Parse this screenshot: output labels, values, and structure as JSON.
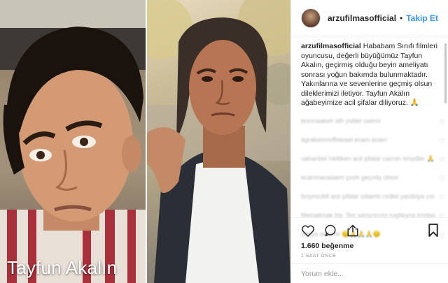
{
  "post": {
    "photo_caption": "Tayfun Akalın"
  },
  "header": {
    "username": "arzufilmasofficial",
    "separator": "•",
    "follow_label": "Takip Et"
  },
  "caption": {
    "username": "arzufilmasofficial",
    "text": " Hababam Sınıfı filmleri oyuncusu, değerli büyüğümüz Tayfun Akalın, geçirmiş olduğu beyin ameliyatı sonrası yoğun bakımda bulunmaktadır. Yakınlarına ve sevenlerine geçmiş olsun dileklerimizi iletiyor. Tayfun Akalın ağabeyimize acil şifalar diliyoruz. 🙏"
  },
  "comments": [
    {
      "text": "tesnnaakeh sth ystlier ceemi",
      "heart": "♡"
    },
    {
      "text": "agrakenmoffsteael ecam ecam",
      "heart": "♡"
    },
    {
      "text": "uahanbel Helliken acil şifalar cacnin nmydler 🙏",
      "heart": "♡"
    },
    {
      "text": "ecanmanaiaem çooh geçmtş olson",
      "heart": "♡"
    },
    {
      "text": "fssymcddl acil şifalar cdaerin nrdlet yardiriya cm",
      "heart": "♡"
    },
    {
      "text": "Meinalimak hiy. Teo sarsırsrırnı rugiteyna lrnnlas",
      "heart": "♡"
    },
    {
      "text": "athiya secerel 😔🙏🙏🙏😔",
      "heart": "♡"
    }
  ],
  "actions": {
    "likes": "1.660 beğenme",
    "time": "1 SAAT ÖNCE"
  },
  "comment_input": {
    "placeholder": "Yorum ekle..."
  },
  "icons": {
    "like": "heart-outline-icon",
    "comment": "comment-bubble-icon",
    "share": "share-icon",
    "save": "bookmark-icon"
  },
  "colors": {
    "follow": "#3897f0",
    "text": "#262626",
    "muted": "#999999",
    "border": "#efefef"
  }
}
